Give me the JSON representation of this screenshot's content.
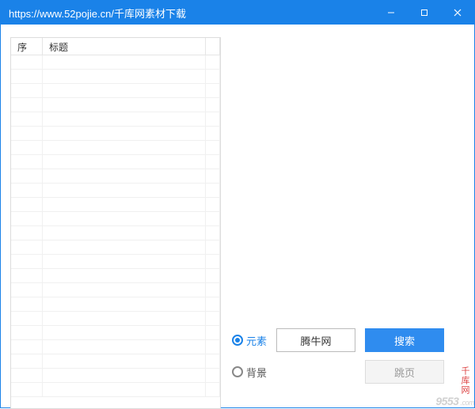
{
  "window": {
    "title": "https://www.52pojie.cn/千库网素材下载"
  },
  "list": {
    "headers": {
      "seq": "序",
      "title": "标题"
    },
    "empty_row_count": 24
  },
  "controls": {
    "radio_yuansu": "元素",
    "radio_beijing": "背景",
    "btn_tengniu": "腾牛网",
    "btn_search": "搜索",
    "btn_jumppage": "跳页"
  },
  "watermark": {
    "side_text": "千库网",
    "corner_main": "9553",
    "corner_sub": ".com"
  }
}
